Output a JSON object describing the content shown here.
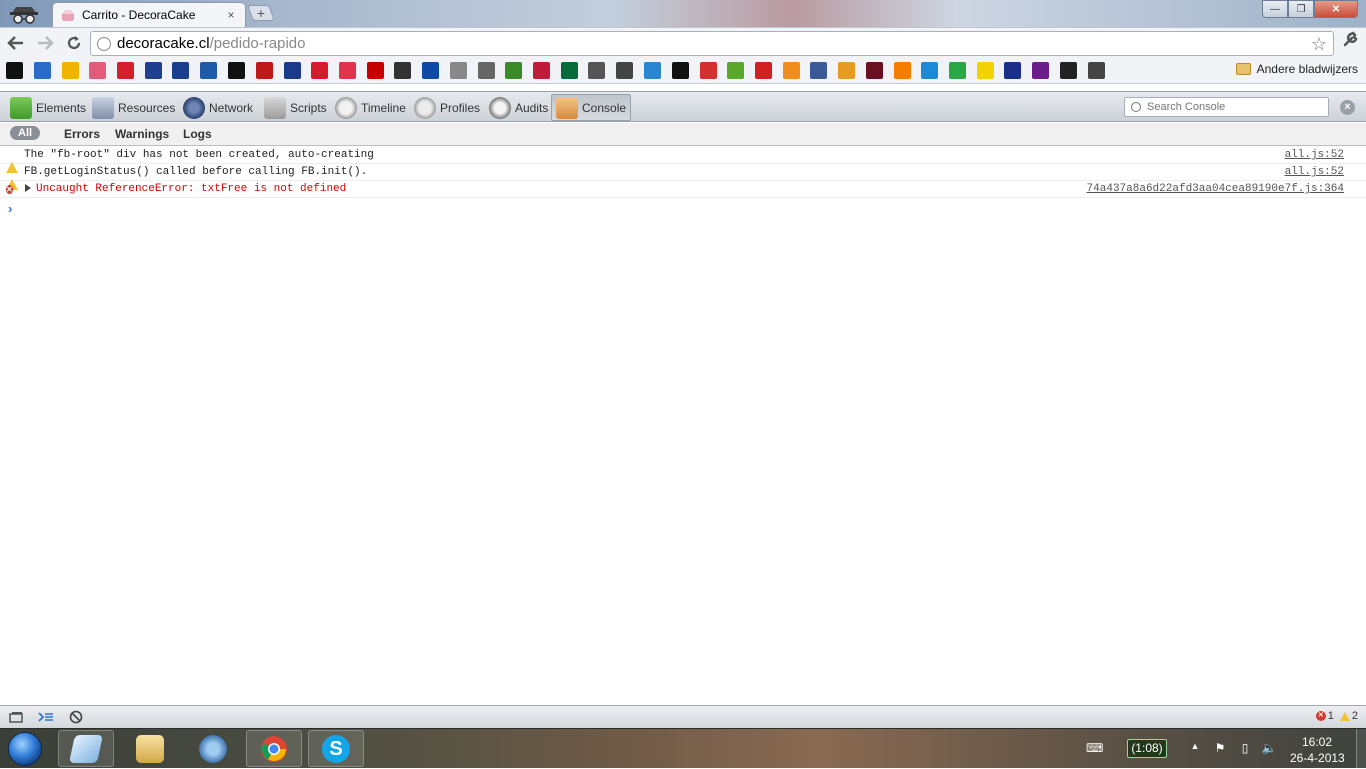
{
  "browser": {
    "tab_title": "Carrito - DecoraCake",
    "tab_close": "×",
    "new_tab": "+",
    "url_host": "decoracake.cl",
    "url_path": "/pedido-rapido",
    "other_bookmarks": "Andere bladwijzers",
    "bookmark_icons": [
      "wikipedia",
      "weather",
      "sun",
      "apps",
      "record",
      "nos",
      "p",
      "t",
      "nyt",
      "ats",
      "vn",
      "pocket",
      "grid",
      "cnn",
      "joystick",
      "fm",
      "target",
      "globe",
      "fw",
      "feedly",
      "leaf",
      "globe",
      "xe",
      "translate",
      "wp",
      "lastfm",
      "chef",
      "rtl",
      "redcircle",
      "rss",
      "facebook",
      "arrow",
      "bat",
      "blogger",
      "klm",
      "coin",
      "dot",
      "ryanair",
      "w",
      "bus",
      "chef"
    ]
  },
  "devtools": {
    "panels": [
      "Elements",
      "Resources",
      "Network",
      "Scripts",
      "Timeline",
      "Profiles",
      "Audits",
      "Console"
    ],
    "selected_panel": "Console",
    "search_placeholder": "Search Console",
    "filters": [
      "All",
      "Errors",
      "Warnings",
      "Logs"
    ],
    "messages": [
      {
        "level": "warning",
        "text": "The \"fb-root\" div has not been created, auto-creating",
        "source": "all.js:52"
      },
      {
        "level": "warning",
        "text": "FB.getLoginStatus() called before calling FB.init().",
        "source": "all.js:52"
      },
      {
        "level": "error",
        "text": "Uncaught ReferenceError: txtFree is not defined",
        "source": "74a437a8a6d22afd3aa04cea89190e7f.js:364"
      }
    ],
    "prompt": "›",
    "error_count": "1",
    "warning_count": "2"
  },
  "taskbar": {
    "battery_time": "(1:08)",
    "clock_time": "16:02",
    "clock_date": "26-4-2013"
  },
  "colors": {
    "error_red": "#d00000",
    "warning_yellow": "#f1c232",
    "prompt_blue": "#2a74d8"
  }
}
